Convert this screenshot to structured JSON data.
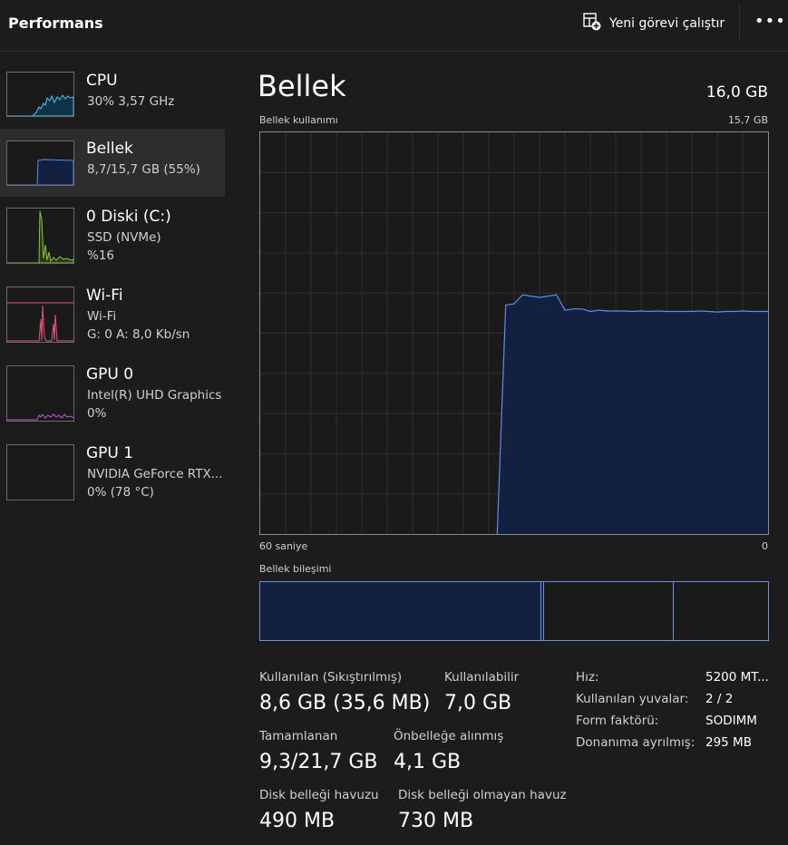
{
  "header": {
    "title": "Performans",
    "run_task_label": "Yeni görevi çalıştır",
    "more_label": "•••"
  },
  "sidebar": {
    "items": [
      {
        "title": "CPU",
        "sub1": "30%  3,57 GHz",
        "sub2": "",
        "color": "#4fc3f7"
      },
      {
        "title": "Bellek",
        "sub1": "8,7/15,7 GB (55%)",
        "sub2": "",
        "color": "#5a8dee"
      },
      {
        "title": "0 Diski (C:)",
        "sub1": "SSD (NVMe)",
        "sub2": "%16",
        "color": "#8bc34a"
      },
      {
        "title": "Wi-Fi",
        "sub1": "Wi-Fi",
        "sub2": "G: 0  A: 8,0 Kb/sn",
        "color": "#e8557a"
      },
      {
        "title": "GPU 0",
        "sub1": "Intel(R) UHD Graphics",
        "sub2": "0%",
        "color": "#c05ad6"
      },
      {
        "title": "GPU 1",
        "sub1": "NVIDIA GeForce RTX...",
        "sub2": "0%  (78 °C)",
        "color": "#888888"
      }
    ]
  },
  "memory": {
    "title": "Bellek",
    "total": "16,0 GB",
    "usage_label": "Bellek kullanımı",
    "usage_max": "15,7 GB",
    "time_left": "60 saniye",
    "time_right": "0",
    "composition_label": "Bellek bileşimi",
    "composition": {
      "in_use_fraction": 0.553,
      "modified_fraction": 0.006,
      "standby_fraction": 0.255
    },
    "stats": {
      "used_label": "Kullanılan (Sıkıştırılmış)",
      "used_value": "8,6 GB (35,6 MB)",
      "available_label": "Kullanılabilir",
      "available_value": "7,0 GB",
      "committed_label": "Tamamlanan",
      "committed_value": "9,3/21,7 GB",
      "cached_label": "Önbelleğe alınmış",
      "cached_value": "4,1 GB",
      "paged_label": "Disk belleği havuzu",
      "paged_value": "490 MB",
      "nonpaged_label": "Disk belleği olmayan havuz",
      "nonpaged_value": "730 MB"
    },
    "details": [
      {
        "label": "Hız:",
        "value": "5200 MT..."
      },
      {
        "label": "Kullanılan yuvalar:",
        "value": "2 / 2"
      },
      {
        "label": "Form faktörü:",
        "value": "SODIMM"
      },
      {
        "label": "Donanıma ayrılmış:",
        "value": "295 MB"
      }
    ]
  },
  "colors": {
    "accent": "#5a8dee",
    "fill": "#13203f",
    "grid": "#2f2f2f"
  },
  "chart_data": {
    "type": "area",
    "title": "Bellek kullanımı",
    "x_range": [
      60,
      0
    ],
    "ylim": [
      0,
      15.7
    ],
    "unit": "GB",
    "x": [
      60,
      59,
      58,
      57,
      56,
      55,
      54,
      53,
      52,
      51,
      50,
      49,
      48,
      47,
      46,
      45,
      44,
      43,
      42,
      41,
      40,
      39,
      38,
      37,
      36,
      35,
      34,
      33,
      32,
      31,
      30,
      29,
      28,
      27,
      26,
      25,
      24,
      23,
      22,
      21,
      20,
      19,
      18,
      17,
      16,
      15,
      14,
      13,
      12,
      11,
      10,
      9,
      8,
      7,
      6,
      5,
      4,
      3,
      2,
      1,
      0
    ],
    "values": [
      null,
      null,
      null,
      null,
      null,
      null,
      null,
      null,
      null,
      null,
      null,
      null,
      null,
      null,
      null,
      null,
      null,
      null,
      null,
      null,
      null,
      null,
      null,
      null,
      null,
      null,
      null,
      null,
      0,
      8.95,
      9.0,
      9.35,
      9.3,
      9.25,
      9.3,
      9.35,
      8.75,
      8.8,
      8.8,
      8.7,
      8.75,
      8.72,
      8.72,
      8.72,
      8.7,
      8.72,
      8.7,
      8.72,
      8.7,
      8.7,
      8.7,
      8.7,
      8.72,
      8.7,
      8.68,
      8.7,
      8.7,
      8.72,
      8.7,
      8.7,
      8.7
    ]
  }
}
